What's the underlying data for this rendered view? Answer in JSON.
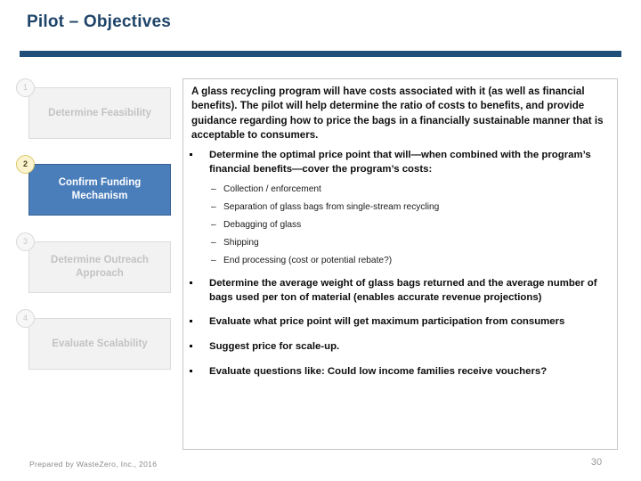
{
  "slide": {
    "title": "Pilot – Objectives",
    "accent_color": "#1F4E79",
    "title_color": "#1F4469",
    "active_box_color": "#4A7EBB",
    "active_badge_color": "#FBF3CE",
    "inactive_box_color": "#F2F2F2",
    "inactive_text_color": "#C3C3C3"
  },
  "steps": [
    {
      "number": "1",
      "label": "Determine Feasibility",
      "state": "inactive"
    },
    {
      "number": "2",
      "label": "Confirm Funding Mechanism",
      "state": "active"
    },
    {
      "number": "3",
      "label": "Determine Outreach Approach",
      "state": "inactive"
    },
    {
      "number": "4",
      "label": "Evaluate Scalability",
      "state": "inactive"
    }
  ],
  "content": {
    "intro": "A glass recycling program will have costs associated with it (as well as financial benefits).  The pilot will help determine the ratio of costs to benefits, and provide guidance regarding how to price the bags in a financially sustainable manner that is acceptable to consumers.",
    "bullets": [
      "Determine the optimal price point that will—when combined with the program’s financial benefits—cover the program’s costs:",
      "Determine the average weight of glass bags returned and the average number of bags used per ton of material (enables accurate revenue projections)",
      "Evaluate what price point will get maximum participation from consumers",
      "Suggest price for scale-up.",
      "Evaluate questions like: Could low income families receive vouchers?"
    ],
    "sub_bullets": [
      "Collection / enforcement",
      "Separation of glass bags from single-stream recycling",
      "Debagging of glass",
      "Shipping",
      "End processing (cost or potential rebate?)"
    ],
    "sub_bullet_marker": "–"
  },
  "footer": {
    "credit": "Prepared by WasteZero, Inc., 2016",
    "page_number": "30"
  }
}
